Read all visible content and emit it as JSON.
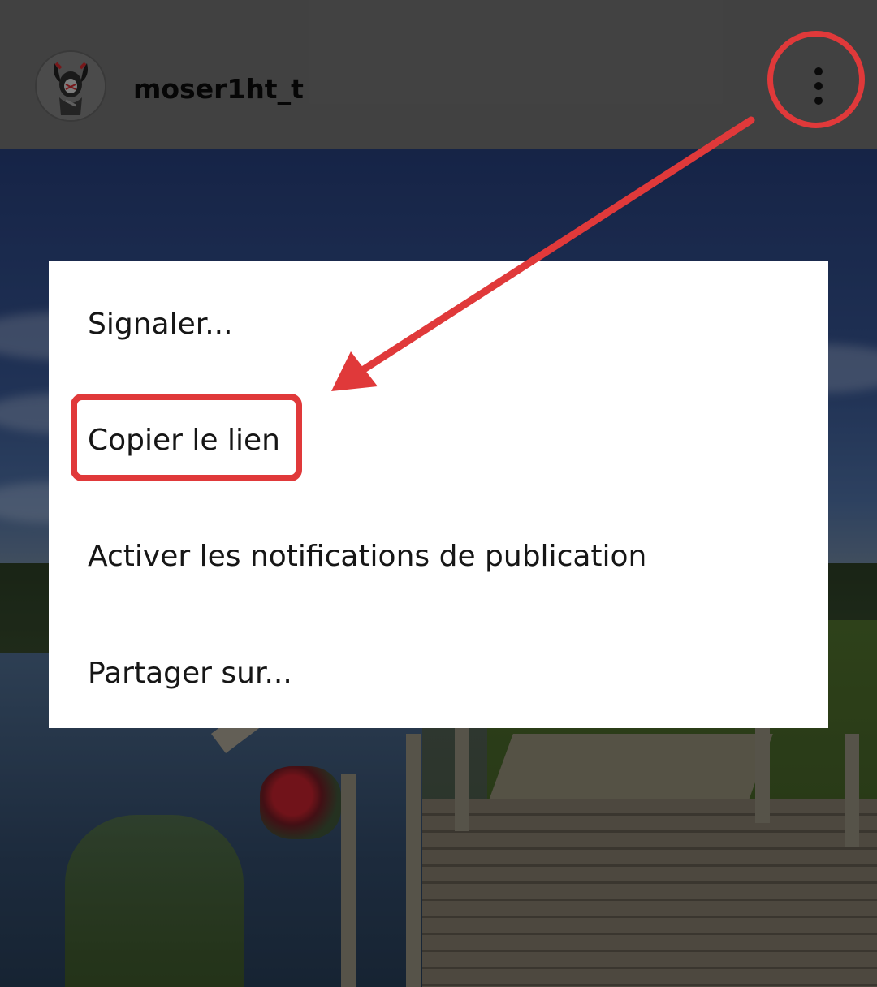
{
  "header": {
    "username": "moser1ht_t",
    "avatar_icon": "demon-avatar-icon",
    "more_icon": "more-vertical-icon"
  },
  "menu": {
    "items": [
      {
        "label": "Signaler..."
      },
      {
        "label": "Copier le lien"
      },
      {
        "label": "Activer les notifications de publication"
      },
      {
        "label": "Partager sur..."
      }
    ]
  },
  "annotations": {
    "color": "#e0393a",
    "highlighted_item": "Copier le lien"
  },
  "colors": {
    "header_background": "#6a6a6a",
    "menu_background": "#ffffff",
    "annotation_red": "#e0393a"
  }
}
